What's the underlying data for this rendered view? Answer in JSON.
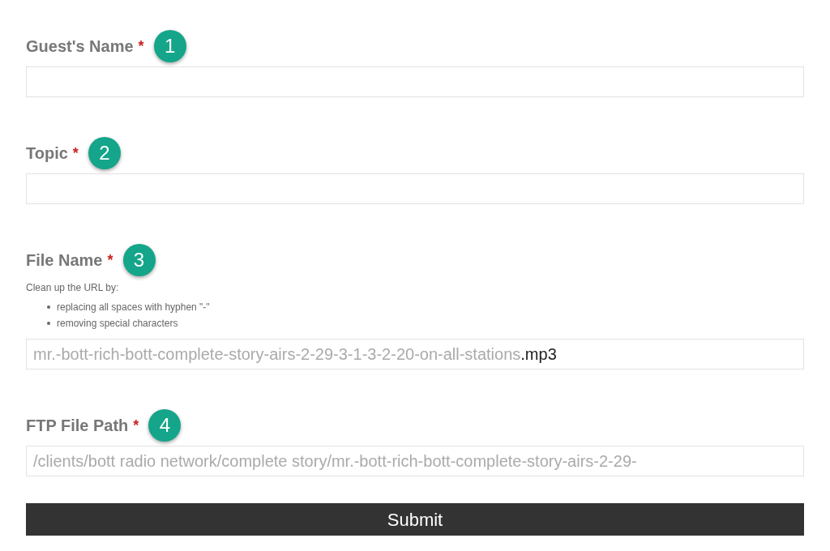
{
  "fields": [
    {
      "label": "Guest's Name",
      "required_mark": "*",
      "badge": "1"
    },
    {
      "label": "Topic",
      "required_mark": "*",
      "badge": "2"
    },
    {
      "label": "File Name",
      "required_mark": "*",
      "badge": "3",
      "help": {
        "intro": "Clean up the URL by:",
        "bullets": [
          "replacing all spaces with hyphen \"-\"",
          "removing special characters"
        ]
      },
      "value_blurred": "mr.-bott-rich-bott-complete-story-airs-2-29-3-1-3-2-20-on-all-stations",
      "value": ".mp3"
    },
    {
      "label": "FTP File Path",
      "required_mark": "*",
      "badge": "4",
      "value_blurred": "/clients/bott radio network/complete story/mr.-bott-rich-bott-complete-story-airs-2-29-"
    }
  ],
  "submit": "Submit"
}
